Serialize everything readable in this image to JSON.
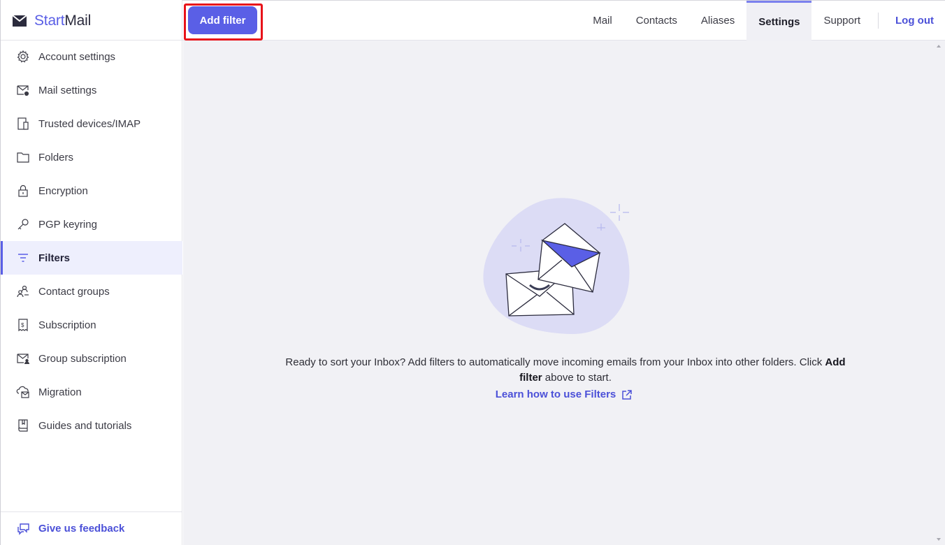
{
  "brand": {
    "name_part1": "Start",
    "name_part2": "Mail",
    "color": "#5a5fe6"
  },
  "sidebar": {
    "items": [
      {
        "label": "Account settings",
        "icon": "gear-icon"
      },
      {
        "label": "Mail settings",
        "icon": "mail-settings-icon"
      },
      {
        "label": "Trusted devices/IMAP",
        "icon": "devices-icon"
      },
      {
        "label": "Folders",
        "icon": "folder-icon"
      },
      {
        "label": "Encryption",
        "icon": "lock-icon"
      },
      {
        "label": "PGP keyring",
        "icon": "key-icon"
      },
      {
        "label": "Filters",
        "icon": "filter-icon",
        "active": true
      },
      {
        "label": "Contact groups",
        "icon": "contact-groups-icon"
      },
      {
        "label": "Subscription",
        "icon": "receipt-icon"
      },
      {
        "label": "Group subscription",
        "icon": "group-mail-icon"
      },
      {
        "label": "Migration",
        "icon": "cloud-mail-icon"
      },
      {
        "label": "Guides and tutorials",
        "icon": "book-icon"
      }
    ],
    "feedback_label": "Give us feedback"
  },
  "topbar": {
    "add_filter_label": "Add filter",
    "tabs": [
      {
        "label": "Mail"
      },
      {
        "label": "Contacts"
      },
      {
        "label": "Aliases"
      },
      {
        "label": "Settings",
        "active": true
      },
      {
        "label": "Support"
      }
    ],
    "logout_label": "Log out"
  },
  "main": {
    "empty_text_1": "Ready to sort your Inbox? Add filters to automatically move incoming emails from your Inbox into other folders. Click ",
    "empty_text_bold": "Add filter",
    "empty_text_2": " above to start.",
    "learn_link": "Learn how to use Filters"
  },
  "colors": {
    "accent": "#5a5fe6",
    "highlight_frame": "#e8131a",
    "background": "#f1f1f5"
  }
}
